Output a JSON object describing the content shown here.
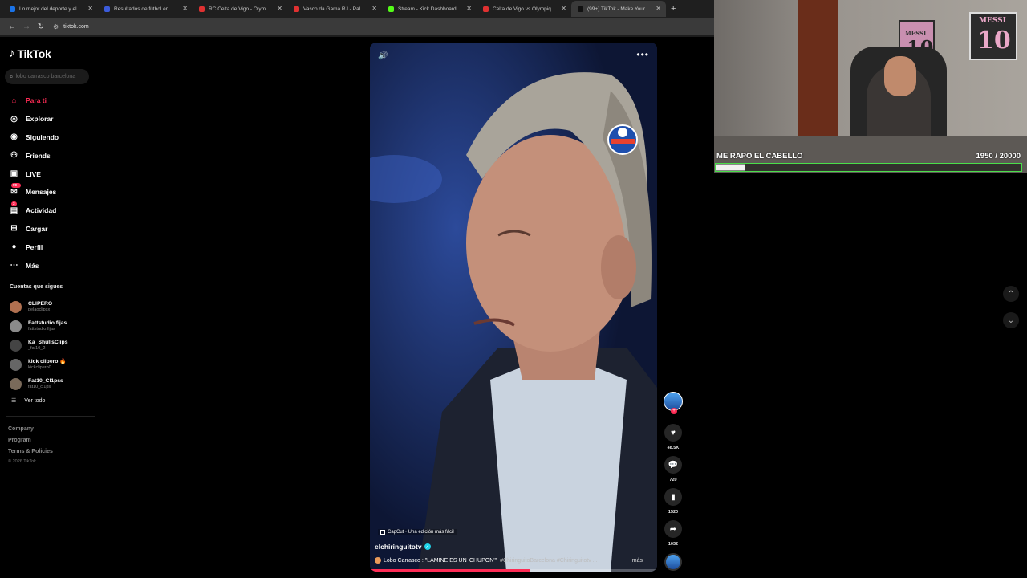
{
  "browser": {
    "tabs": [
      {
        "label": "Lo mejor del deporte y el entretenimiento",
        "color": "#1a73e8",
        "active": false
      },
      {
        "label": "Resultados de fútbol en directo",
        "color": "#3b5bdb",
        "active": false
      },
      {
        "label": "RC Celta de Vigo - Olympique Lyon",
        "color": "#e03131",
        "active": false
      },
      {
        "label": "Vasco da Gama RJ - Palmeiras",
        "color": "#e03131",
        "active": false
      },
      {
        "label": "Stream - Kick Dashboard",
        "color": "#53fc18",
        "active": false
      },
      {
        "label": "Celta de Vigo vs Olympique Lyon",
        "color": "#e03131",
        "active": false
      },
      {
        "label": "(99+) TikTok - Make Your Day",
        "color": "#111111",
        "active": true
      }
    ],
    "url": "tiktok.com"
  },
  "tiktok": {
    "logo": "TikTok",
    "search_placeholder": "lobo carrasco barcelona",
    "nav": [
      {
        "label": "Para ti",
        "icon": "home-icon",
        "glyph": "⌂",
        "active": true,
        "badge": ""
      },
      {
        "label": "Explorar",
        "icon": "compass-icon",
        "glyph": "◎",
        "active": false,
        "badge": ""
      },
      {
        "label": "Siguiendo",
        "icon": "following-icon",
        "glyph": "◉",
        "active": false,
        "badge": ""
      },
      {
        "label": "Friends",
        "icon": "friends-icon",
        "glyph": "⚇",
        "active": false,
        "badge": ""
      },
      {
        "label": "LIVE",
        "icon": "live-icon",
        "glyph": "▣",
        "active": false,
        "badge": ""
      },
      {
        "label": "Mensajes",
        "icon": "messages-icon",
        "glyph": "✉",
        "active": false,
        "badge": "99+"
      },
      {
        "label": "Actividad",
        "icon": "activity-icon",
        "glyph": "▤",
        "active": false,
        "badge": "3"
      },
      {
        "label": "Cargar",
        "icon": "upload-icon",
        "glyph": "⊞",
        "active": false,
        "badge": ""
      },
      {
        "label": "Perfil",
        "icon": "profile-icon",
        "glyph": "●",
        "active": false,
        "badge": ""
      },
      {
        "label": "Más",
        "icon": "more-icon",
        "glyph": "⋯",
        "active": false,
        "badge": ""
      }
    ],
    "following_title": "Cuentas que sigues",
    "following": [
      {
        "name": "CLIPERO",
        "user": "pelaoclipsx",
        "color": "#b07050"
      },
      {
        "name": "Fattstudio fijas",
        "user": "fattstudio.fijas",
        "color": "#8a8a8a"
      },
      {
        "name": "Ka_ShullsClips",
        "user": "_fat10_2",
        "color": "#444"
      },
      {
        "name": "kick clipero 🔥",
        "user": "kickclipero0",
        "color": "#666"
      },
      {
        "name": "Fat10_Cl1pss",
        "user": "fat10_cl1ps",
        "color": "#7a6a5a"
      }
    ],
    "see_all": "Ver todo",
    "footer": [
      "Company",
      "Program",
      "Terms & Policies"
    ],
    "copyright": "© 2026 TikTok"
  },
  "video": {
    "capcut_label": "CapCut · Una edición más fácil",
    "author": "elchiringuitotv",
    "caption_main": "Lobo Carrasco : \"LAMINE ES UN 'CHUPON'\"",
    "caption_tags": "#ChiringuitoBarcelona   #Chiringuitotv ...",
    "caption_more": "más",
    "progress": 0.56
  },
  "actions": {
    "likes": "48.5K",
    "comments": "720",
    "saves": "1520",
    "shares": "1032"
  },
  "overlay": {
    "goal_title": "ME RAPO EL CABELLO",
    "goal_current": "1950",
    "goal_target": "/ 20000",
    "goal_fraction": 0.0975,
    "frame_small": "10",
    "frame_small_label": "MESSI",
    "frame_large": "10",
    "frame_large_label": "MESSI"
  }
}
